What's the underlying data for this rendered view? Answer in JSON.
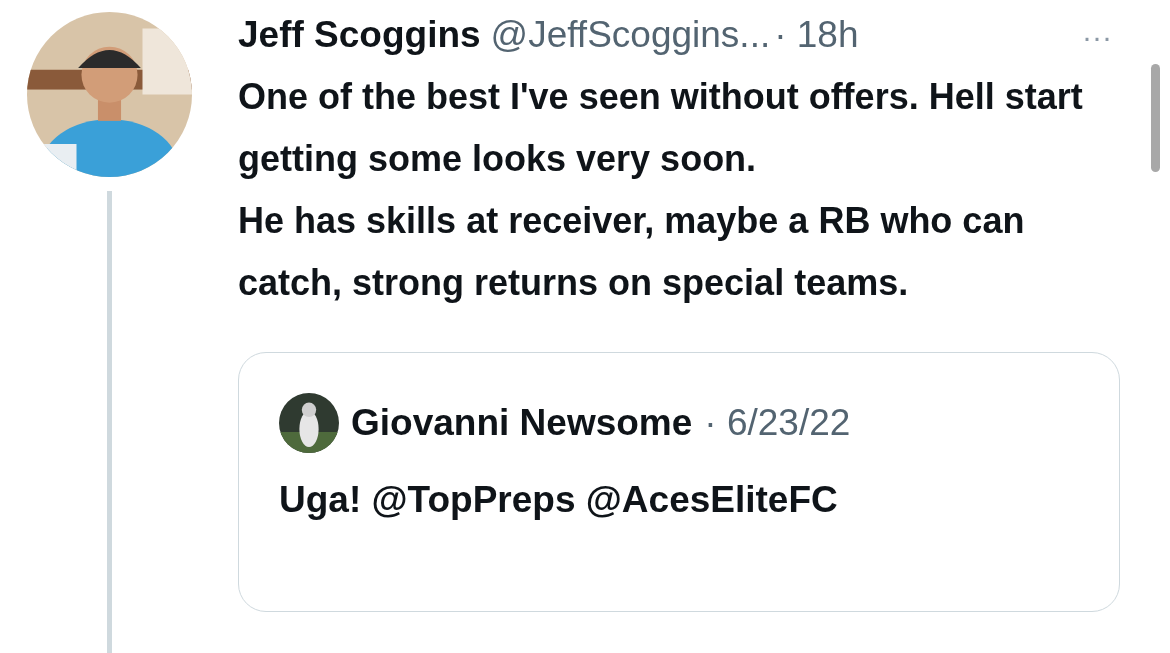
{
  "tweet": {
    "author": {
      "name": "Jeff Scoggins",
      "handle": "@JeffScoggins...",
      "time": "· 18h"
    },
    "more": "···",
    "paragraphs": [
      "One of the best I've seen without offers. Hell start getting some looks very soon.",
      "He has skills at receiver, maybe a RB who can catch, strong returns on special teams."
    ],
    "quote": {
      "name": "Giovanni Newsome",
      "time": "· 6/23/22",
      "text": "Uga! @TopPreps @AcesEliteFC"
    }
  }
}
